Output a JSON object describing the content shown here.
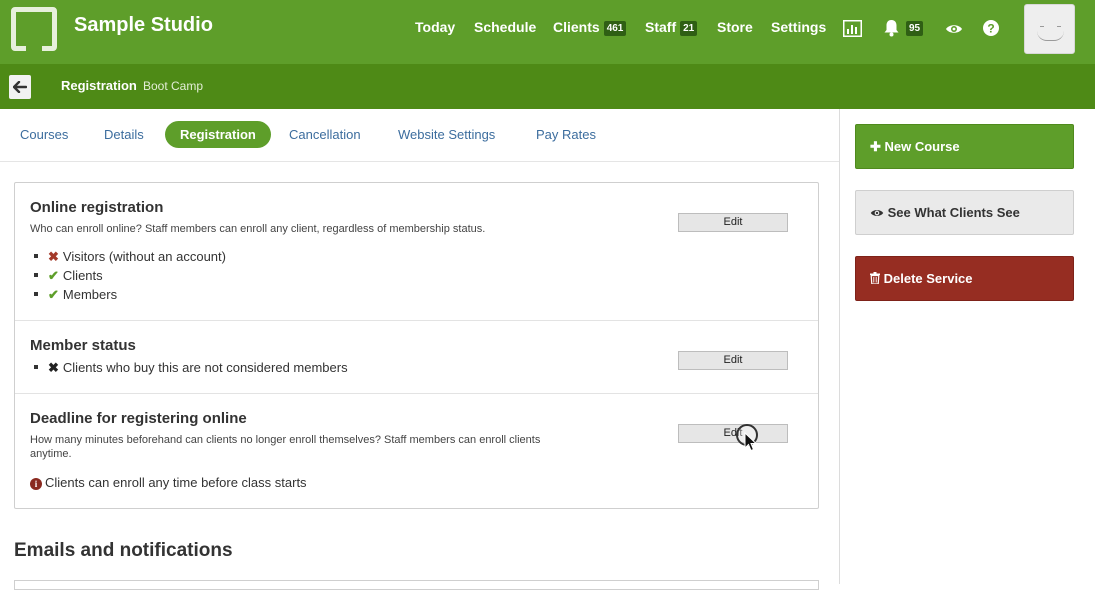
{
  "brand": {
    "name": "Sample Studio"
  },
  "nav": {
    "today": "Today",
    "schedule": "Schedule",
    "clients": "Clients",
    "clients_count": "461",
    "staff": "Staff",
    "staff_count": "21",
    "store": "Store",
    "settings": "Settings",
    "notifications_count": "95"
  },
  "breadcrumb": {
    "title": "Registration",
    "subtitle": "Boot Camp"
  },
  "tabs": [
    "Courses",
    "Details",
    "Registration",
    "Cancellation",
    "Website Settings",
    "Pay Rates"
  ],
  "active_tab": "Registration",
  "sections": {
    "online_registration": {
      "title": "Online registration",
      "description": "Who can enroll online? Staff members can enroll any client, regardless of membership status.",
      "edit_label": "Edit",
      "items": [
        {
          "label": "Visitors (without an account)",
          "status": "not-allowed"
        },
        {
          "label": "Clients",
          "status": "allowed"
        },
        {
          "label": "Members",
          "status": "allowed"
        }
      ]
    },
    "member_status": {
      "title": "Member status",
      "edit_label": "Edit",
      "item": "Clients who buy this are not considered members"
    },
    "deadline": {
      "title": "Deadline for registering online",
      "description": "How many minutes beforehand can clients no longer enroll themselves? Staff members can enroll clients anytime.",
      "edit_label": "Edit",
      "info": "Clients can enroll any time before class starts"
    }
  },
  "emails_heading": "Emails and notifications",
  "sidebar": {
    "new_course": "New Course",
    "see_what_clients_see": "See What Clients See",
    "delete_service": "Delete Service"
  },
  "colors": {
    "brand_green": "#5e9e2a",
    "subbar_green": "#4e8a16",
    "danger_red": "#962d22",
    "link_blue": "#3c6d9e"
  }
}
